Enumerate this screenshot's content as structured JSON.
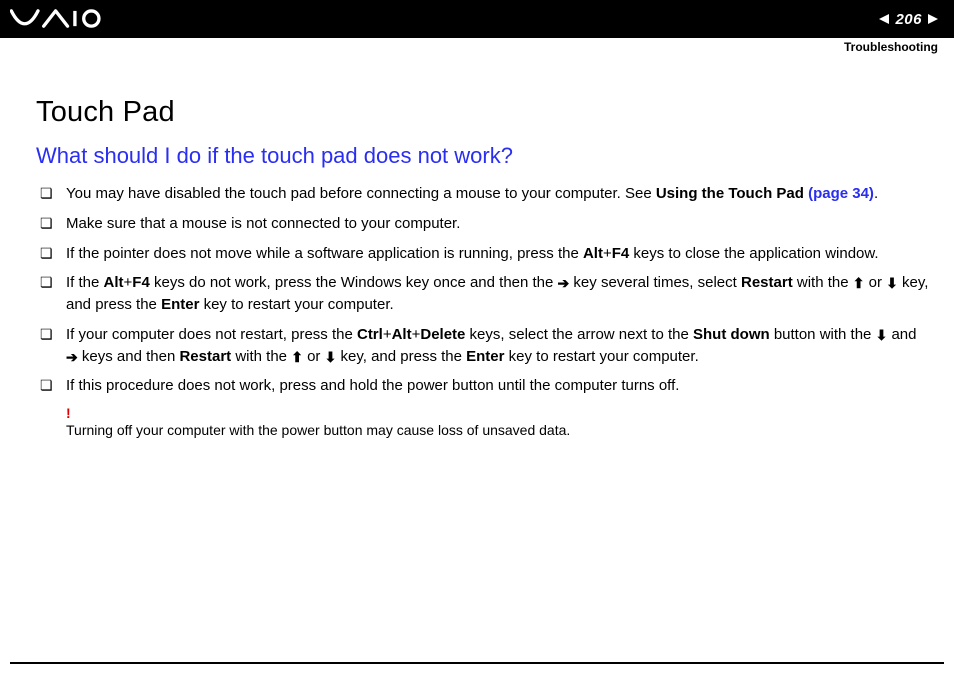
{
  "header": {
    "page_number": "206",
    "subtitle": "Troubleshooting"
  },
  "section": {
    "title": "Touch Pad",
    "question": "What should I do if the touch pad does not work?"
  },
  "items": {
    "i1_pre": "You may have disabled the touch pad before connecting a mouse to your computer. See ",
    "i1_bold": "Using the Touch Pad ",
    "i1_link": "(page 34)",
    "i1_post": ".",
    "i2": "Make sure that a mouse is not connected to your computer.",
    "i3_a": "If the pointer does not move while a software application is running, press the ",
    "i3_b": "Alt",
    "i3_c": "+",
    "i3_d": "F4",
    "i3_e": " keys to close the application window.",
    "i4_a": "If the ",
    "i4_b": "Alt",
    "i4_c": "+",
    "i4_d": "F4",
    "i4_e": " keys do not work, press the Windows key once and then the ",
    "i4_f": " key several times, select ",
    "i4_g": "Restart",
    "i4_h": " with the ",
    "i4_i": " or ",
    "i4_j": " key, and press the ",
    "i4_k": "Enter",
    "i4_l": " key to restart your computer.",
    "i5_a": "If your computer does not restart, press the ",
    "i5_b": "Ctrl",
    "i5_c": "+",
    "i5_d": "Alt",
    "i5_e": "+",
    "i5_f": "Delete",
    "i5_g": " keys, select the arrow next to the ",
    "i5_h": "Shut down",
    "i5_i": " button with the ",
    "i5_j": " and ",
    "i5_k": " keys and then ",
    "i5_l": "Restart",
    "i5_m": " with the ",
    "i5_n": " or ",
    "i5_o": " key, and press the ",
    "i5_p": "Enter",
    "i5_q": " key to restart your computer.",
    "i6": "If this procedure does not work, press and hold the power button until the computer turns off."
  },
  "warning": {
    "mark": "!",
    "text": "Turning off your computer with the power button may cause loss of unsaved data."
  },
  "glyphs": {
    "arrow_right": "➔",
    "arrow_up": "⬆",
    "arrow_down": "⬇"
  }
}
